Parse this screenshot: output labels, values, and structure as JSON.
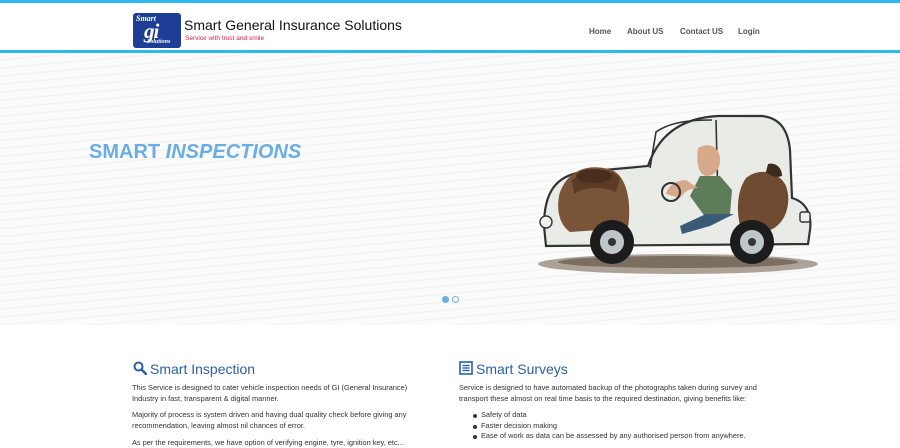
{
  "brand": {
    "logo_line1": "Smart",
    "logo_line2": "gi",
    "logo_line3": "Solutions",
    "name": "Smart General Insurance Solutions",
    "tagline": "Service with trust and smile"
  },
  "nav": {
    "items": [
      "Home",
      "About US",
      "Contact US",
      "Login"
    ]
  },
  "hero": {
    "title_plain": "SMART ",
    "title_italic": "INSPECTIONS",
    "image_description": "cartoon-car-illustration",
    "slides_total": 2,
    "slide_active": 1
  },
  "sections": [
    {
      "icon": "search-icon",
      "title": "Smart Inspection",
      "paragraphs": [
        "This Service is designed to cater vehicle inspection needs of GI (General Insurance) Industry in fast, transparent & digital manner.",
        "Majority of process is system driven and having dual quality check before giving any recommendation, leaving almost nil chances of error.",
        "As per the requirements, we have option of verifying engine, tyre, ignition key, etc..."
      ]
    },
    {
      "icon": "list-icon",
      "title": "Smart Surveys",
      "paragraphs": [
        "Service is designed to have automated backup of the photographs taken during survey and transport these almost on real time basis to the required destination, giving benefits like:"
      ],
      "bullets": [
        "Safety of data",
        "Faster decision making",
        "Ease of work as data can be assessed by any authorised person from anywhere."
      ]
    }
  ],
  "colors": {
    "accent_bar": "#2fb8f0",
    "hero_title": "#6aaee4",
    "section_title": "#2b5fa8",
    "tagline": "#e0204a",
    "logo_bg": "#1d3e94"
  }
}
